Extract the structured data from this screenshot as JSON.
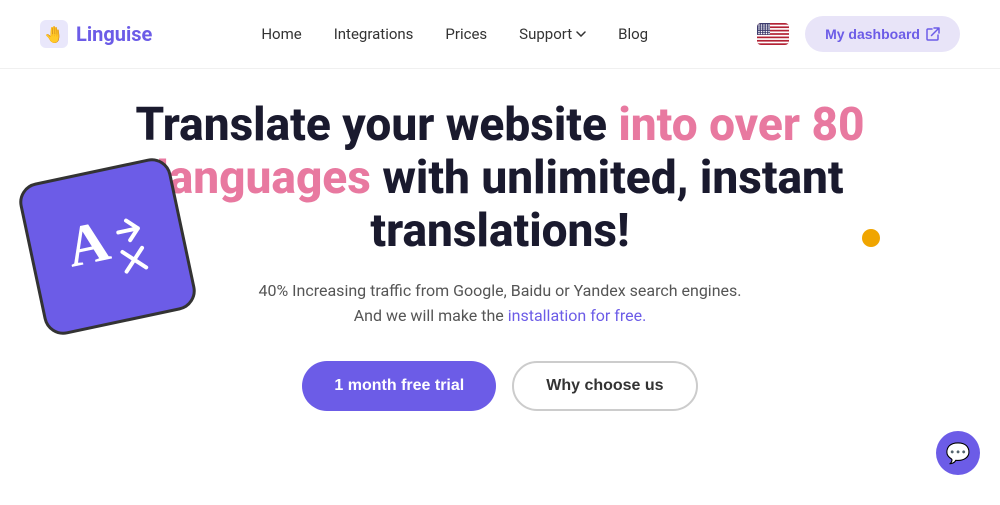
{
  "brand": {
    "name": "Linguise",
    "logo_alt": "Linguise logo"
  },
  "navbar": {
    "links": [
      {
        "label": "Home",
        "has_arrow": false
      },
      {
        "label": "Integrations",
        "has_arrow": false
      },
      {
        "label": "Prices",
        "has_arrow": false
      },
      {
        "label": "Support",
        "has_arrow": true
      },
      {
        "label": "Blog",
        "has_arrow": false
      }
    ],
    "dashboard_button": "My dashboard",
    "flag_alt": "US flag"
  },
  "hero": {
    "title_part1": "Translate your website ",
    "title_highlight": "into over 80 languages",
    "title_part2": " with unlimited, instant translations!",
    "subtitle_line1": "40% Increasing traffic from Google, Baidu or Yandex search engines.",
    "subtitle_line2": "And we will make the ",
    "subtitle_link": "installation for free.",
    "cta_primary": "1 month free trial",
    "cta_secondary": "Why choose us"
  },
  "decorative": {
    "translate_symbol": "A",
    "chat_icon": "💬"
  }
}
